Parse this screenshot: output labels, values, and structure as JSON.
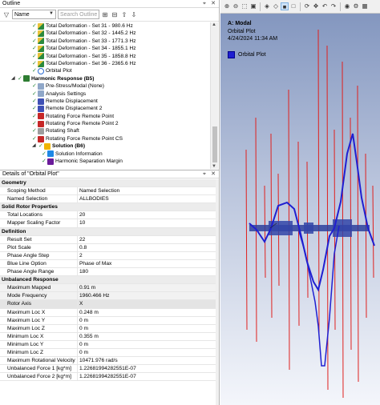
{
  "outline": {
    "title": "Outline",
    "filter_dropdown": "Name",
    "search_placeholder": "Search Outline",
    "tree": [
      {
        "label": "Total Deformation - Set 31 - 980.6 Hz",
        "icon": "deformation-icon",
        "indent": 1,
        "bold": false
      },
      {
        "label": "Total Deformation - Set 32 - 1445.2 Hz",
        "icon": "deformation-icon",
        "indent": 1,
        "bold": false
      },
      {
        "label": "Total Deformation - Set 33 - 1771.3 Hz",
        "icon": "deformation-icon",
        "indent": 1,
        "bold": false
      },
      {
        "label": "Total Deformation - Set 34 - 1855.1 Hz",
        "icon": "deformation-icon",
        "indent": 1,
        "bold": false
      },
      {
        "label": "Total Deformation - Set 35 - 1858.8 Hz",
        "icon": "deformation-icon",
        "indent": 1,
        "bold": false
      },
      {
        "label": "Total Deformation - Set 36 - 2365.6 Hz",
        "icon": "deformation-icon",
        "indent": 1,
        "bold": false
      },
      {
        "label": "Orbital Plot",
        "icon": "orbital-plot-icon",
        "indent": 1,
        "bold": false
      },
      {
        "label": "Harmonic Response (B5)",
        "icon": "harmonic-response-icon",
        "indent": 0,
        "bold": true,
        "expander": true
      },
      {
        "label": "Pre-Stress/Modal (None)",
        "icon": "prestress-icon",
        "indent": 1,
        "bold": false
      },
      {
        "label": "Analysis Settings",
        "icon": "analysis-settings-icon",
        "indent": 1,
        "bold": false
      },
      {
        "label": "Remote Displacement",
        "icon": "remote-displacement-icon",
        "indent": 1,
        "bold": false
      },
      {
        "label": "Remote Displacement 2",
        "icon": "remote-displacement-icon",
        "indent": 1,
        "bold": false
      },
      {
        "label": "Rotating Force Remote Point",
        "icon": "rotating-force-icon",
        "indent": 1,
        "bold": false
      },
      {
        "label": "Rotating Force Remote Point 2",
        "icon": "rotating-force-icon",
        "indent": 1,
        "bold": false
      },
      {
        "label": "Rotating Shaft",
        "icon": "rotating-shaft-icon",
        "indent": 1,
        "bold": false
      },
      {
        "label": "Rotating Force Remote Point CS",
        "icon": "rotating-force-icon",
        "indent": 1,
        "bold": false
      },
      {
        "label": "Solution (B6)",
        "icon": "solution-icon",
        "indent": 1,
        "bold": true,
        "expander": true
      },
      {
        "label": "Solution Information",
        "icon": "solution-information-icon",
        "indent": 2,
        "bold": false
      },
      {
        "label": "Harmonic Separation Margin",
        "icon": "separation-margin-icon",
        "indent": 2,
        "bold": false
      }
    ]
  },
  "details": {
    "title": "Details of \"Orbital Plot\"",
    "rows": [
      {
        "type": "section",
        "label": "Geometry"
      },
      {
        "label": "Scoping Method",
        "value": "Named Selection"
      },
      {
        "label": "Named Selection",
        "value": "ALLBODIES"
      },
      {
        "type": "section",
        "label": "Solid Rotor Properties"
      },
      {
        "label": "Total Locations",
        "value": "20"
      },
      {
        "label": "Mapper Scaling Factor",
        "value": "10"
      },
      {
        "type": "section",
        "label": "Definition"
      },
      {
        "label": "Result Set",
        "value": "22"
      },
      {
        "label": "Plot Scale",
        "value": "0.8"
      },
      {
        "label": "Phase Angle Step",
        "value": "2"
      },
      {
        "label": "Blue Line Option",
        "value": "Phase of Max"
      },
      {
        "label": "Phase Angle Range",
        "value": "180"
      },
      {
        "type": "section",
        "label": "Unbalanced Response"
      },
      {
        "label": "Maximum Mapped",
        "value": "0.91 m",
        "highlight": true
      },
      {
        "label": "Mode Frequency",
        "value": "1960.466 Hz",
        "highlight": true
      },
      {
        "label": "Rotor Axis",
        "value": "X",
        "selected": true
      },
      {
        "label": "Maximum Loc X",
        "value": "0.248 m"
      },
      {
        "label": "Maximum Loc Y",
        "value": "0 m"
      },
      {
        "label": "Maximum Loc Z",
        "value": "0 m"
      },
      {
        "label": "Minimum Loc X",
        "value": "0.355 m"
      },
      {
        "label": "Minimum Loc Y",
        "value": "0 m"
      },
      {
        "label": "Minimum Loc Z",
        "value": "0 m"
      },
      {
        "label": "Maximum Rotational Velocity",
        "value": "10471.976 rad/s"
      },
      {
        "label": "Unbalanced Force 1 [kg*m]",
        "value": "1.22681994282551E-07"
      },
      {
        "label": "Unbalanced Force 2 [kg*m]",
        "value": "1.22681994282551E-07"
      }
    ]
  },
  "viewport": {
    "system": "A: Modal",
    "result": "Orbital Plot",
    "datetime": "4/24/2024 11:34 AM",
    "legend_label": "Orbital Plot",
    "legend_color": "#1f1fd1",
    "orbit_line_color": "#e0201e",
    "toolbar_icons": [
      "zoom-in-icon",
      "zoom-out-icon",
      "zoom-fit-icon",
      "box-zoom-icon",
      "view-icon",
      "wireframe-icon",
      "solid-view-icon",
      "edge-icon",
      "rotate-icon",
      "pan-icon",
      "undo-icon",
      "redo-icon",
      "camera-icon",
      "settings-icon",
      "grid-icon"
    ]
  }
}
